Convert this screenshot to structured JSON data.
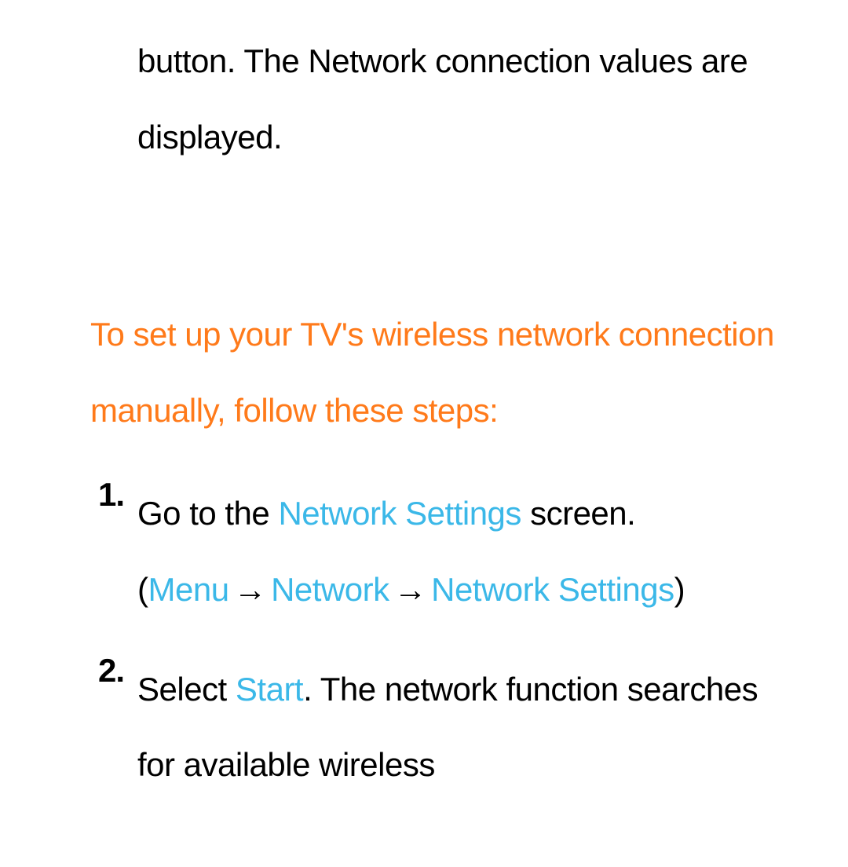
{
  "top_paragraph": "button. The Network connection values are displayed.",
  "section_heading": "To set up your TV's wireless network connection manually, follow these steps:",
  "steps": [
    {
      "number": "1.",
      "text_before_1": "Go to the ",
      "highlight_1": "Network Settings",
      "text_after_1": " screen. (",
      "nav_menu": "Menu",
      "nav_network": "Network",
      "nav_network_settings": "Network Settings",
      "closing_paren": ")"
    },
    {
      "number": "2.",
      "text_before_1": "Select ",
      "highlight_1": "Start",
      "text_after_1": ". The network function searches for available wireless"
    }
  ],
  "arrow": "→"
}
